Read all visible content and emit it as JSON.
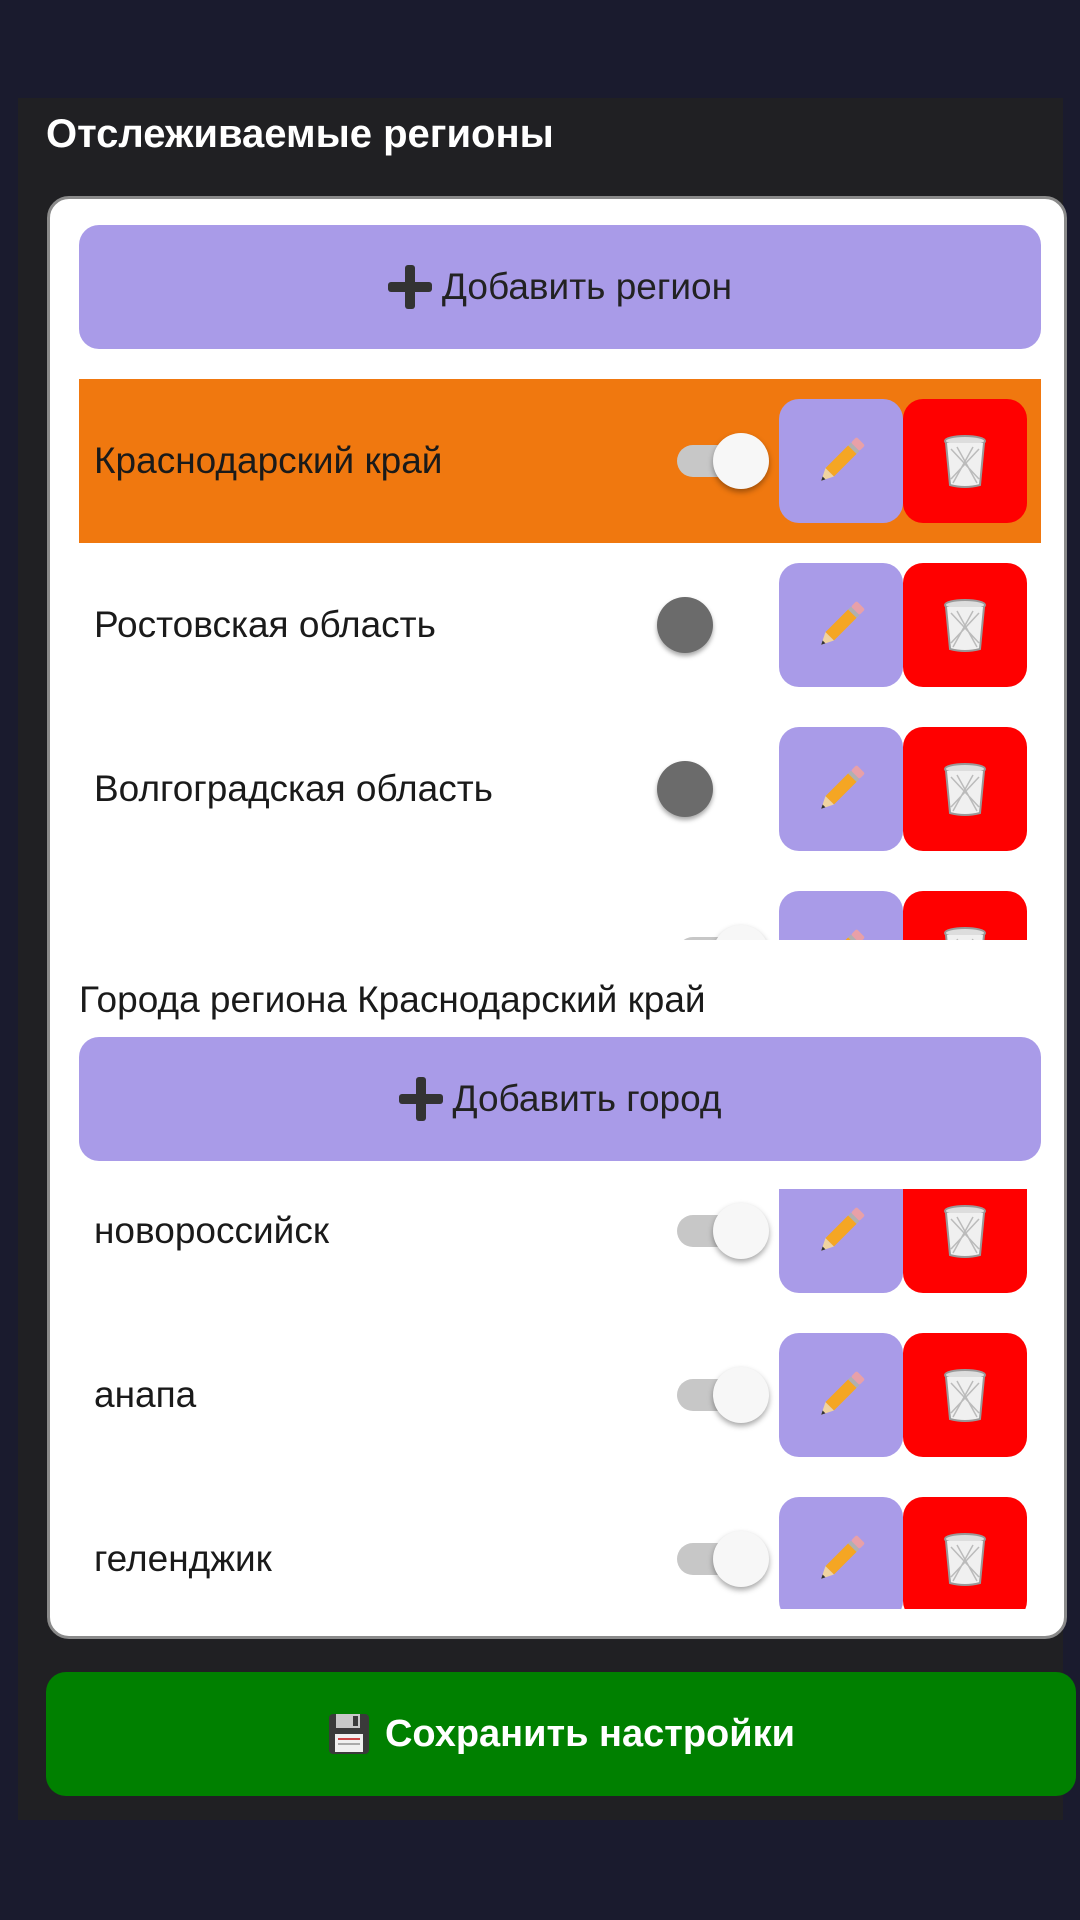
{
  "regions_section": {
    "title": "Отслеживаемые регионы",
    "add_region_label": "Добавить регион",
    "items": [
      {
        "label": "Краснодарский край",
        "enabled": true,
        "selected": true
      },
      {
        "label": "Ростовская область",
        "enabled": false,
        "selected": false
      },
      {
        "label": "Волгоградская область",
        "enabled": false,
        "selected": false
      },
      {
        "label": "",
        "enabled": true,
        "selected": false
      }
    ]
  },
  "cities_section": {
    "title": "Города региона Краснодарский край",
    "add_city_label": "Добавить город",
    "items": [
      {
        "label": "новороссийск",
        "enabled": true
      },
      {
        "label": "анапа",
        "enabled": true
      },
      {
        "label": "геленджик",
        "enabled": true
      }
    ]
  },
  "save_button": {
    "label": "Сохранить настройки"
  },
  "icons": {
    "edit": "pencil-icon",
    "delete": "trash-icon",
    "add": "plus-icon",
    "save": "floppy-disk-icon"
  },
  "colors": {
    "page_background": "#1a1b2e",
    "panel_background": "#202023",
    "accent_purple": "#a99be8",
    "selected_row": "#f0780f",
    "delete_red": "#ff0000",
    "save_green": "#008000"
  }
}
